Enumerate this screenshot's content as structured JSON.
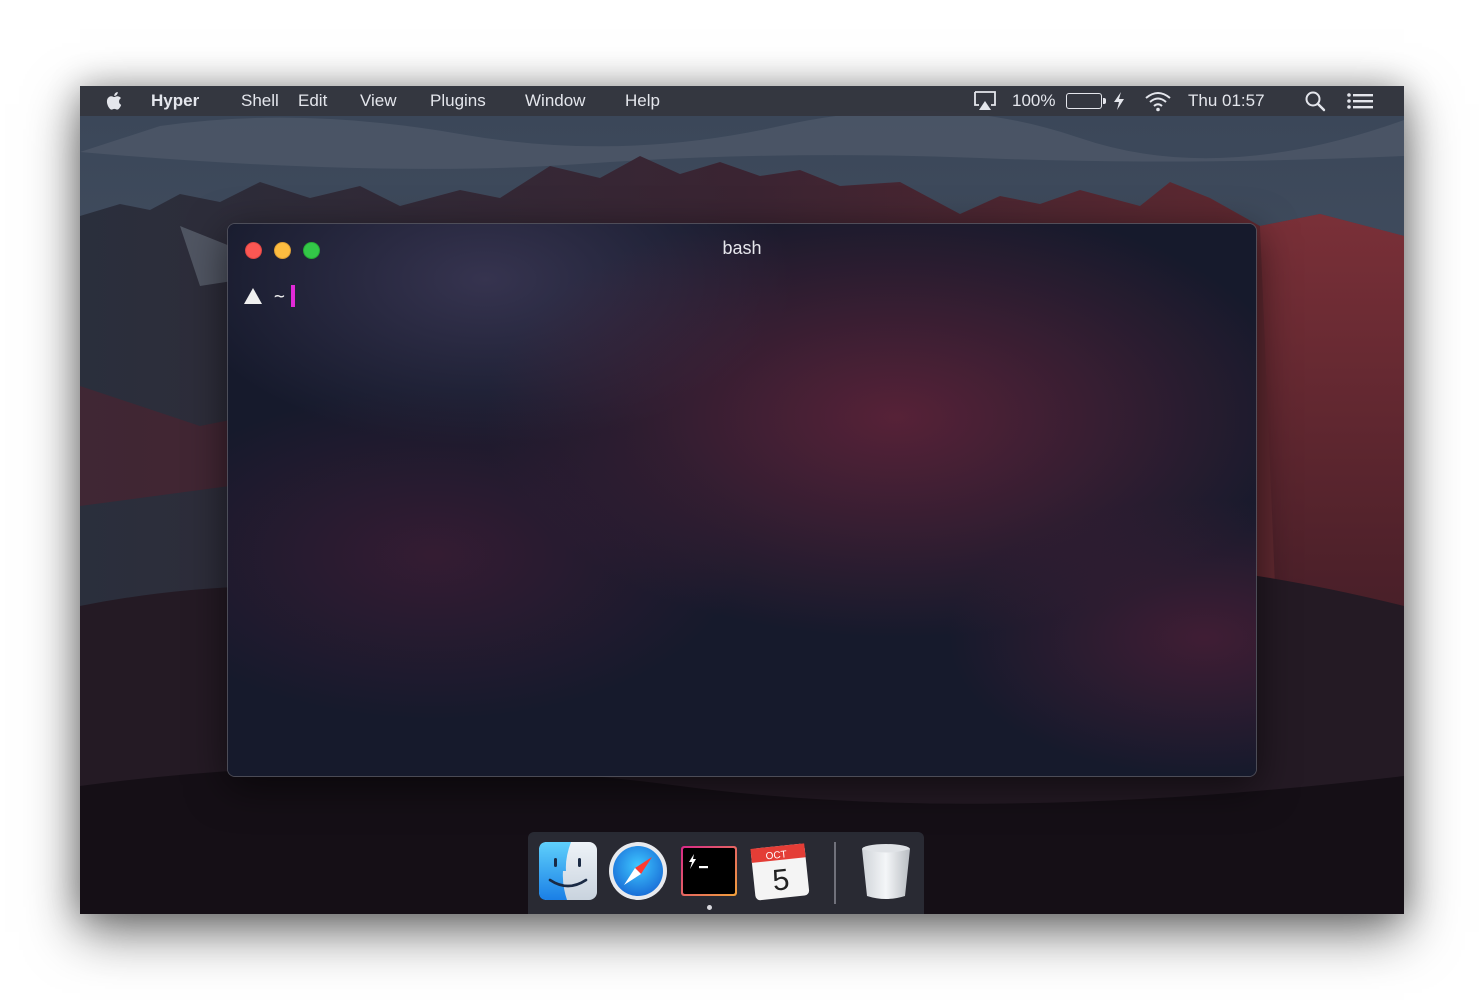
{
  "menubar": {
    "apple_icon": "apple-icon",
    "app_name": "Hyper",
    "menus": [
      "Shell",
      "Edit",
      "View",
      "Plugins",
      "Window",
      "Help"
    ],
    "battery_percent_label": "100%",
    "battery_level": 1.0,
    "clock": "Thu 01:57",
    "status_icons": [
      "airplay-icon",
      "battery-icon",
      "charging-bolt-icon",
      "wifi-icon",
      "spotlight-search-icon",
      "notification-center-icon"
    ]
  },
  "terminal": {
    "title": "bash",
    "prompt_symbol": "▲",
    "cwd": "~",
    "cursor_color": "#e22ad8",
    "buttons": [
      "close-button",
      "minimize-button",
      "zoom-button"
    ]
  },
  "dock": {
    "apps": [
      "finder-icon",
      "safari-icon",
      "hyper-icon",
      "calendar-icon"
    ],
    "trash": "trash-icon",
    "calendar_month": "OCT",
    "calendar_day": "5",
    "running_app": "hyper-icon"
  },
  "colors": {
    "menubar_bg": "#343640",
    "traffic_close": "#fc5753",
    "traffic_minimize": "#fdbc40",
    "traffic_zoom": "#33c748",
    "dock_bg": "#2c2e38"
  }
}
